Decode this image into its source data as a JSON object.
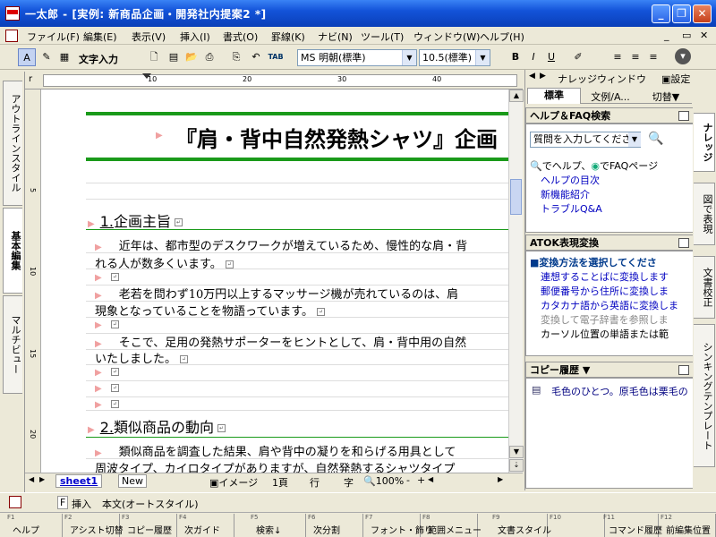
{
  "window": {
    "title": "一太郎 - [実例: 新商品企画・開発社内提案2 *]"
  },
  "menu": [
    "ファイル(F)",
    "編集(E)",
    "表示(V)",
    "挿入(I)",
    "書式(O)",
    "罫線(K)",
    "ナビ(N)",
    "ツール(T)",
    "ウィンドウ(W)",
    "ヘルプ(H)"
  ],
  "toolbar": {
    "input_mode": "文字入力",
    "font": "MS 明朝(標準)",
    "size": "10.5(標準)",
    "tab_label": "TAB"
  },
  "left_tabs": [
    "アウトラインスタイル",
    "基本編集",
    "マルチビュー"
  ],
  "ruler_numbers": [
    "10",
    "20",
    "30",
    "40"
  ],
  "vruler_numbers": [
    "5",
    "10",
    "15",
    "20"
  ],
  "document": {
    "title": "『肩・背中自然発熱シャツ』企画",
    "heading1": {
      "num": "1.",
      "text": "企画主旨"
    },
    "para1a": "近年は、都市型のデスクワークが増えているため、慢性的な肩・背",
    "para1b": "れる人が数多くいます。",
    "para2a": "老若を問わず10万円以上するマッサージ機が売れているのは、肩",
    "para2b": "現象となっていることを物語っています。",
    "para3a": "そこで、足用の発熱サポーターをヒントとして、肩・背中用の自然",
    "para3b": "いたしました。",
    "heading2": {
      "num": "2.",
      "text": "類似商品の動向"
    },
    "para4a": "類似商品を調査した結果、肩や背中の凝りを和らげる用具として",
    "para4b": "周波タイプ、カイロタイプがありますが、自然発熱するシャツタイプ"
  },
  "sheet_tabs": {
    "sheet1": "sheet1",
    "new": "New"
  },
  "doc_status": {
    "image": "イメージ",
    "page": "1頁",
    "line": "行",
    "char": "字",
    "zoom": "100%"
  },
  "knowledge": {
    "header": "ナレッジウィンドウ",
    "setting": "設定",
    "tabs": [
      "標準",
      "文例/A...",
      "切替"
    ],
    "help_title": "ヘルプ＆FAQ検索",
    "help_placeholder": "質問を入力してくださ",
    "help_links": [
      "でヘルプ、",
      "でFAQページ",
      "ヘルプの目次",
      "新機能紹介",
      "トラブルQ&A"
    ],
    "atok_title": "ATOK表現変換",
    "atok_items": [
      "■変換方法を選択してくださ",
      "連想することばに変換します",
      "郵便番号から住所に変換しま",
      "カタカナ語から英語に変換しま",
      "変換して電子辞書を参照しま",
      "カーソル位置の単語または範"
    ],
    "copy_title": "コピー履歴",
    "copy_item": "毛色のひとつ。原毛色は栗毛の"
  },
  "right_tabs": [
    "ナレッジ",
    "図で表現",
    "文書校正",
    "シンキングテンプレート"
  ],
  "statusbar": {
    "mode": "F",
    "insert": "挿入",
    "style": "本文(オートスタイル)"
  },
  "fkeys": [
    {
      "n": "F1",
      "l": "ヘルプ"
    },
    {
      "n": "F2",
      "l": "アシスト切替"
    },
    {
      "n": "F3",
      "l": "コピー履歴"
    },
    {
      "n": "F4",
      "l": "次ガイド"
    },
    {
      "n": "F5",
      "l": "検索↓"
    },
    {
      "n": "F6",
      "l": "次分割"
    },
    {
      "n": "F7",
      "l": "フォント・飾り"
    },
    {
      "n": "F8",
      "l": "範囲メニュー"
    },
    {
      "n": "F9",
      "l": "文書スタイル"
    },
    {
      "n": "F10",
      "l": ""
    },
    {
      "n": "F11",
      "l": "コマンド履歴"
    },
    {
      "n": "F12",
      "l": "前編集位置"
    }
  ]
}
